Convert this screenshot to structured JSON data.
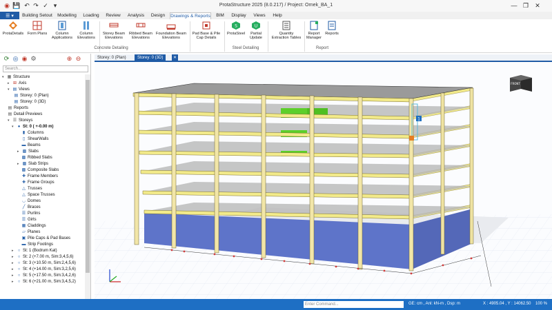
{
  "app": {
    "title": "ProtaStructure 2025 (8.0.217) / Project: Ornek_BA_1"
  },
  "menu": {
    "file_label": "☰ ▾",
    "tabs": [
      "Building Setout",
      "Modelling",
      "Loading",
      "Review",
      "Analysis",
      "Design",
      "Drawings & Reports",
      "BIM",
      "Display",
      "Views",
      "Help"
    ],
    "active_tab": "Drawings & Reports"
  },
  "ribbon": {
    "buttons": [
      "ProtaDetails",
      "Form Plans",
      "Column Applications",
      "Column Elevations",
      "Storey Beam Elevations",
      "Ribbed Beam Elevations",
      "Foundation Beam Elevations",
      "Pad Base & Pile Cap Details",
      "ProtaSteel",
      "Partial Update",
      "Quantity Extraction Tables",
      "Report Manager",
      "Reports"
    ],
    "groups": [
      "Concrete Detailing",
      "Steel Detailing",
      "Report"
    ]
  },
  "left_panel": {
    "search_placeholder": "Search...",
    "tree": [
      "Structure",
      "Axis",
      "Views",
      "Storey: 0 (Plan)",
      "Storey: 0 (3D)",
      "Reports",
      "Detail Previews",
      "Storeys",
      "St: 0 ( +-0.00 m)",
      "Columns",
      "ShearWalls",
      "Beams",
      "Slabs",
      "Ribbed Slabs",
      "Slab Strips",
      "Composite Slabs",
      "Frame Members",
      "Frame Groups",
      "Trusses",
      "Space Trusses",
      "Domes",
      "Braces",
      "Purlins",
      "Girts",
      "Claddings",
      "Planes",
      "Pile Caps & Pad Bases",
      "Strip Footings",
      "St: 1 (Bodrum Kat)",
      "St: 2 (+7.00 m, Sim:3,4,5,6)",
      "St: 3 (+10.50 m, Sim:2,4,5,6)",
      "St: 4 (+14.00 m, Sim:3,2,5,6)",
      "St: 5 (+17.50 m, Sim:3,4,2,6)",
      "St: 6 (+21.00 m, Sim:3,4,5,2)"
    ]
  },
  "doc_tabs": [
    "Storey: 0 (Plan)",
    "Storey: 0 (3D)"
  ],
  "view_cube_label": "FRONT",
  "marker_a": "1",
  "statusbar": {
    "command_placeholder": "Enter Command...",
    "units": "GE: cm , Anl: kN-m , Dsp: m",
    "coords": "X : 4905.04 , Y : 14062.50",
    "zoom": "100 %"
  }
}
